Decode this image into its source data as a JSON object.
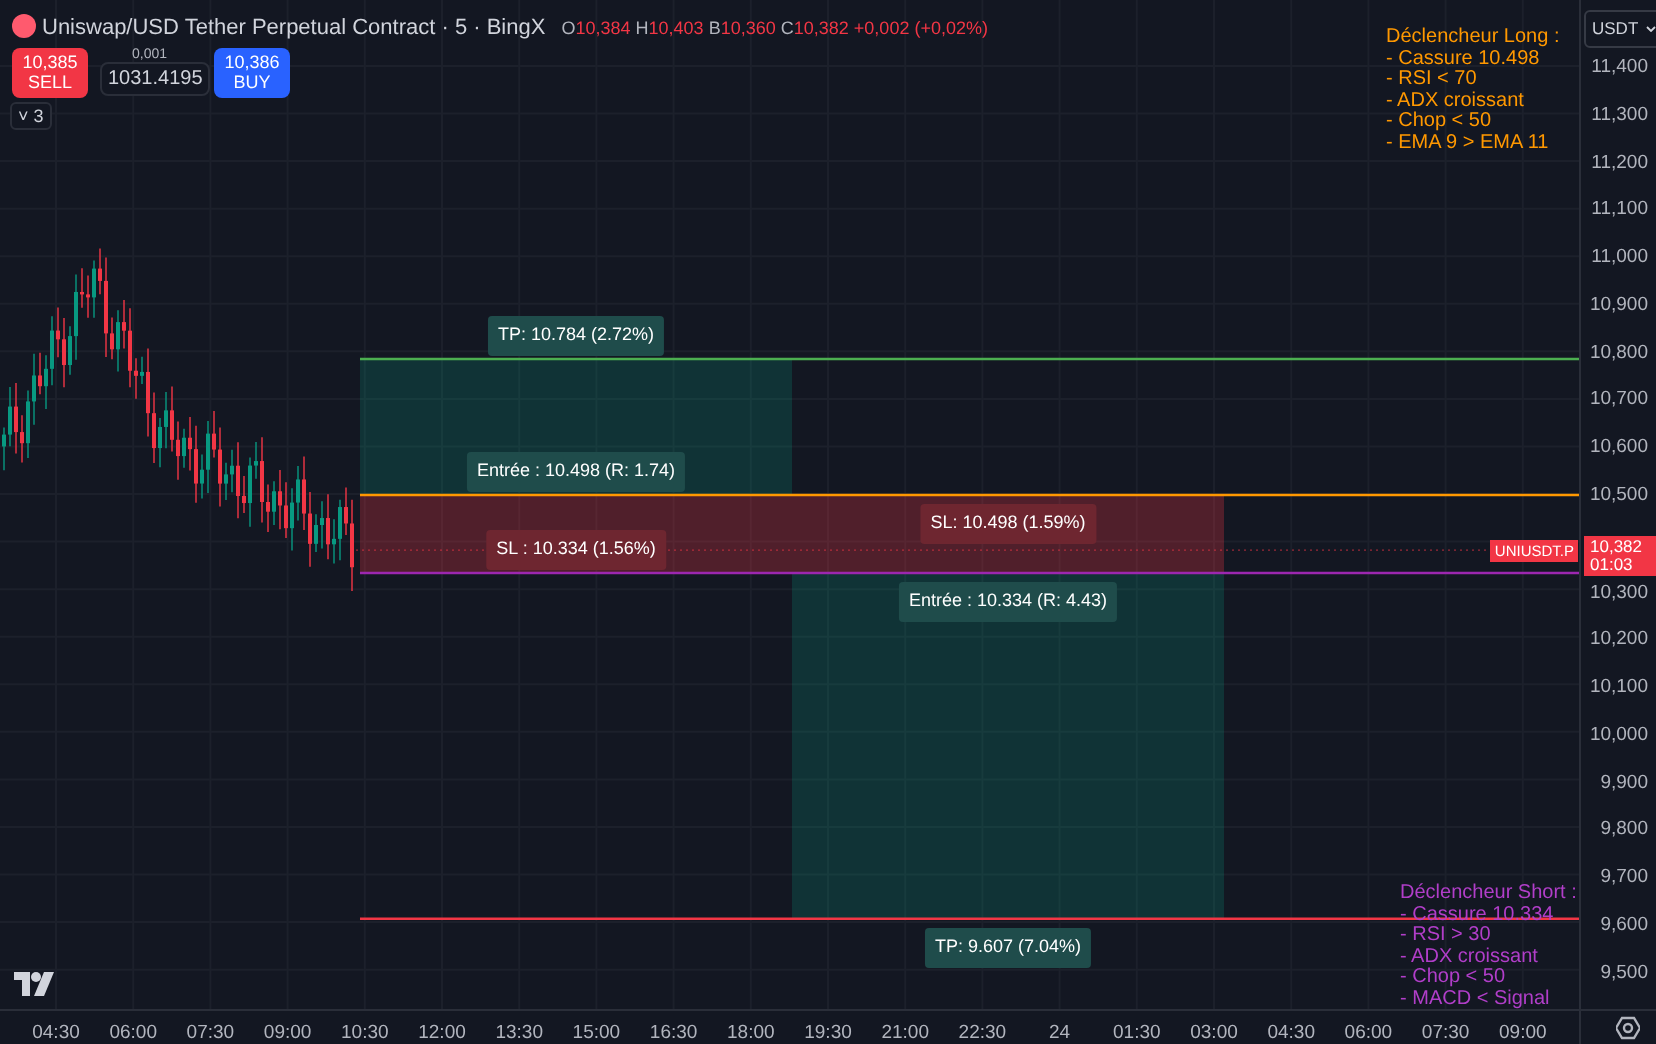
{
  "header": {
    "title": "Uniswap/USD Tether Perpetual Contract · 5 · BingX",
    "ohlc": [
      {
        "label": "O",
        "value": "10,384"
      },
      {
        "label": "H",
        "value": "10,403"
      },
      {
        "label": "B",
        "value": "10,360"
      },
      {
        "label": "C",
        "value": "10,382"
      }
    ],
    "change": "+0,002 (+0,02%)"
  },
  "trade": {
    "sell": {
      "price": "10,385",
      "label": "SELL"
    },
    "spread": "0,001",
    "quantity": "1031.4195",
    "buy": {
      "price": "10,386",
      "label": "BUY"
    }
  },
  "indicators_toggle": {
    "icon": "˅",
    "count": "3"
  },
  "currency": "USDT",
  "price_axis": {
    "upper": [
      "11,400",
      "11,300",
      "11,200",
      "11,100",
      "11,000",
      "10,900",
      "10,800",
      "10,700",
      "10,600",
      "10,500"
    ],
    "lower": [
      "10,300",
      "10,200",
      "10,100",
      "10,000",
      "9,900",
      "9,800",
      "9,700",
      "9,600",
      "9,500"
    ]
  },
  "time_axis": [
    "04:30",
    "06:00",
    "07:30",
    "09:00",
    "10:30",
    "12:00",
    "13:30",
    "15:00",
    "16:30",
    "18:00",
    "19:30",
    "21:00",
    "22:30",
    "24",
    "01:30",
    "03:00",
    "04:30",
    "06:00",
    "07:30",
    "09:00"
  ],
  "notes": [
    {
      "kind": "long",
      "color": "#ff9800",
      "lines": [
        "Déclencheur Long :",
        "- Cassure 10.498",
        "- RSI < 70",
        "- ADX croissant",
        "- Chop < 50",
        "- EMA 9 > EMA 11"
      ]
    },
    {
      "kind": "short",
      "color": "#b13ec9",
      "lines": [
        "Déclencheur Short :",
        "- Cassure 10.334",
        "- RSI > 30",
        "- ADX croissant",
        "- Chop < 50",
        "- MACD < Signal"
      ]
    }
  ],
  "positions": [
    {
      "kind": "long",
      "tp": "TP: 10.784 (2.72%)",
      "entry": "Entrée : 10.498 (R: 1.74)",
      "sl": "SL : 10.334 (1.56%)"
    },
    {
      "kind": "short",
      "tp": "TP: 9.607 (7.04%)",
      "entry": "Entrée : 10.334 (R: 4.43)",
      "sl": "SL: 10.498 (1.59%)"
    }
  ],
  "last_price": {
    "symbol": "UNIUSDT.P",
    "price": "10,382",
    "countdown": "01:03"
  }
}
